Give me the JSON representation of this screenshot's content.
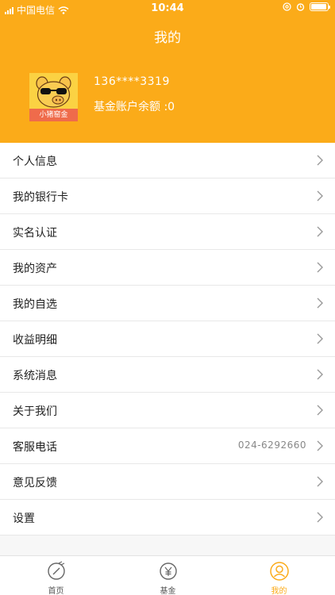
{
  "status_bar": {
    "carrier": "中国电信",
    "time": "10:44",
    "battery_level": 0.95
  },
  "header": {
    "title": "我的",
    "avatar_text": "小猪窑金",
    "phone": "136****3319",
    "balance": "基金账户余额 :0"
  },
  "menu": [
    {
      "label": "个人信息"
    },
    {
      "label": "我的银行卡"
    },
    {
      "label": "实名认证"
    },
    {
      "label": "我的资产"
    },
    {
      "label": "我的自选"
    },
    {
      "label": "收益明细"
    },
    {
      "label": "系统消息"
    },
    {
      "label": "关于我们"
    },
    {
      "label": "客服电话",
      "value": "024-6292660"
    },
    {
      "label": "意见反馈"
    },
    {
      "label": "设置"
    }
  ],
  "tabbar": {
    "tabs": [
      {
        "label": "首页",
        "icon": "home-icon"
      },
      {
        "label": "基金",
        "icon": "yen-icon"
      },
      {
        "label": "我的",
        "icon": "user-icon"
      }
    ],
    "active": "我的"
  },
  "colors": {
    "accent": "#fbab19",
    "avatar_bg": "#fbd243",
    "avatar_strip": "#ef6b4b"
  }
}
